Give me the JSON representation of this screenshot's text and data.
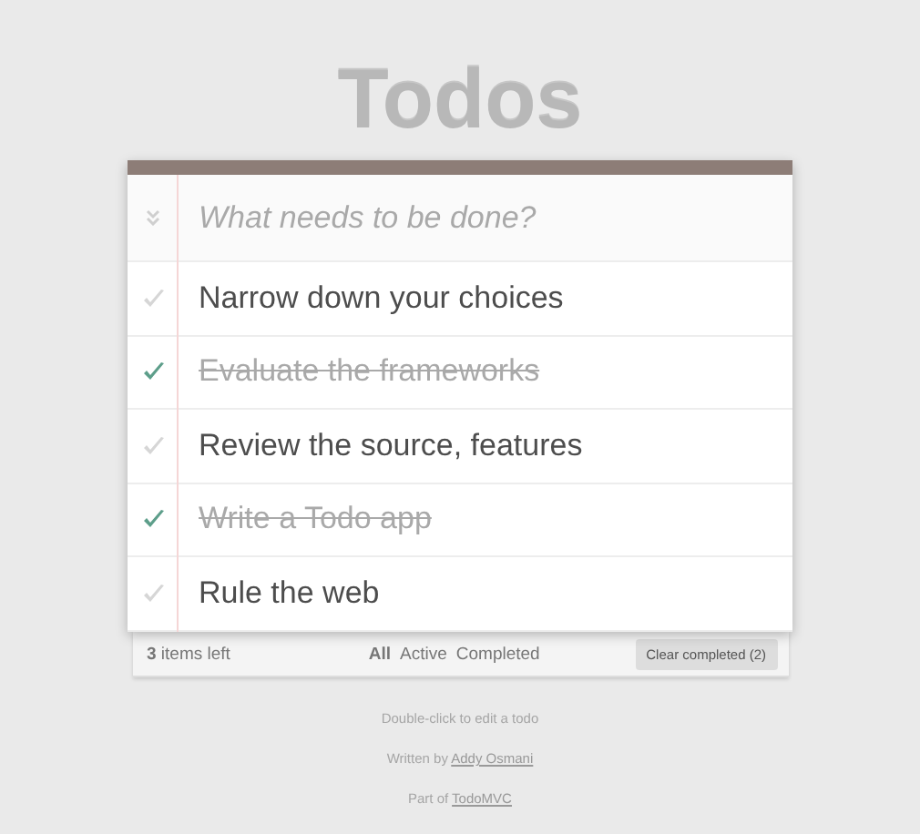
{
  "title": "Todos",
  "new_todo": {
    "placeholder": "What needs to be done?"
  },
  "todos": [
    {
      "label": "Narrow down your choices",
      "completed": false
    },
    {
      "label": "Evaluate the frameworks",
      "completed": true
    },
    {
      "label": "Review the source, features",
      "completed": false
    },
    {
      "label": "Write a Todo app",
      "completed": true
    },
    {
      "label": "Rule the web",
      "completed": false
    }
  ],
  "footer": {
    "count": "**3** items left",
    "filters": [
      {
        "label": "All",
        "selected": true
      },
      {
        "label": "Active",
        "selected": false
      },
      {
        "label": "Completed",
        "selected": false
      }
    ],
    "clear_button": "Clear completed (2)"
  },
  "info": [
    {
      "text": "Double-click to edit a todo"
    },
    {
      "text": "Written by ",
      "link": "Addy Osmani"
    },
    {
      "text": "Part of ",
      "link": "TodoMVC"
    }
  ]
}
